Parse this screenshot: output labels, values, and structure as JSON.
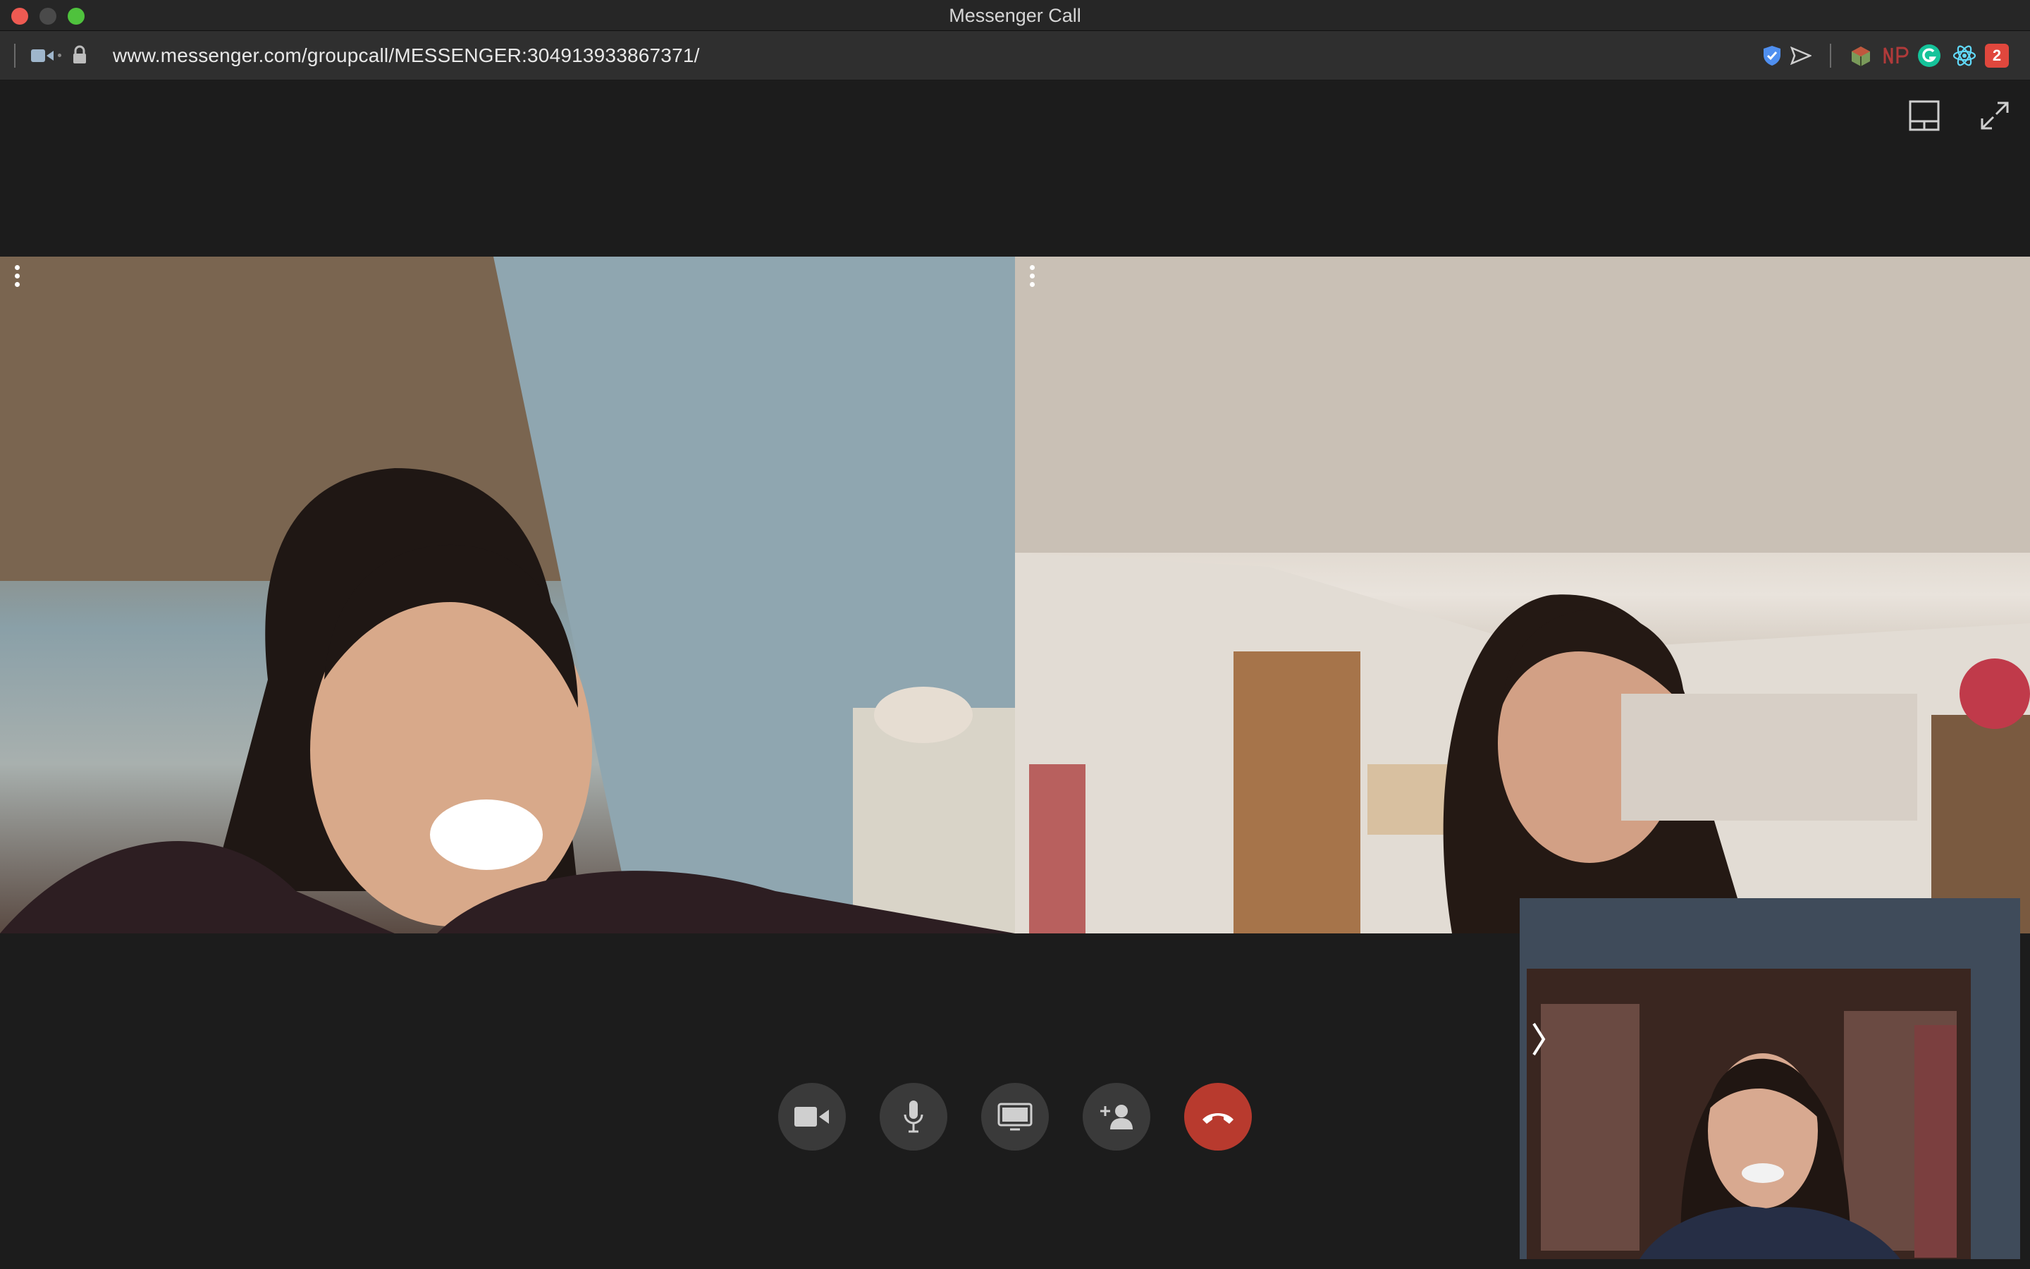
{
  "window": {
    "title": "Messenger Call"
  },
  "browser": {
    "url": "www.messenger.com/groupcall/MESSENGER:304913933867371/",
    "extension_badge": "2"
  },
  "colors": {
    "end_call": "#b83a2e",
    "control_bg": "#3a3a3a",
    "stage_bg": "#1c1c1c"
  },
  "icons": {
    "top_right": [
      "layout-toggle-icon",
      "fullscreen-icon"
    ],
    "controls": [
      "video-camera-icon",
      "microphone-icon",
      "screen-share-icon",
      "add-person-icon",
      "end-call-icon"
    ]
  }
}
